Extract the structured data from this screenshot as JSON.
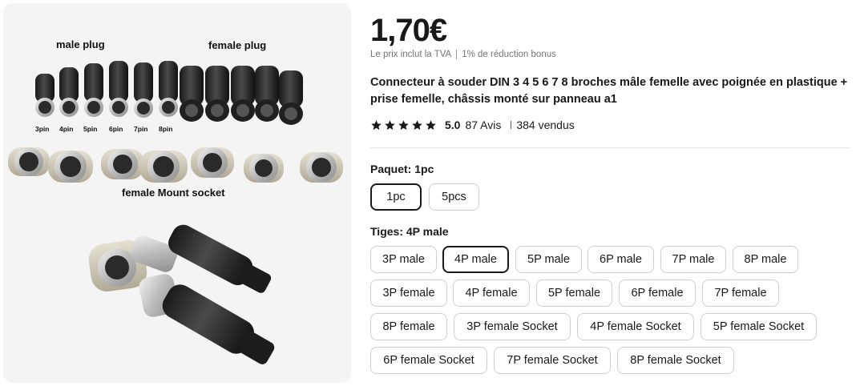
{
  "product": {
    "price": "1,70€",
    "tax_note": "Le prix inclut la TVA",
    "discount_note": "1% de réduction bonus",
    "title": "Connecteur à souder DIN 3 4 5 6 7 8 broches mâle femelle avec poignée en plastique + prise femelle, châssis monté sur panneau a1",
    "rating": "5.0",
    "reviews": "87 Avis",
    "sold": "384 vendus",
    "star_color": "#191919"
  },
  "image": {
    "label_male": "male plug",
    "label_female": "female plug",
    "label_mount": "female Mount  socket",
    "pins": [
      "3pin",
      "4pin",
      "5pin",
      "6pin",
      "7pin",
      "8pin"
    ]
  },
  "package": {
    "label": "Paquet: 1pc",
    "options": [
      "1pc",
      "5pcs"
    ],
    "selected": "1pc"
  },
  "stems": {
    "label": "Tiges: 4P male",
    "options": [
      "3P male",
      "4P male",
      "5P male",
      "6P male",
      "7P male",
      "8P male",
      "3P female",
      "4P female",
      "5P female",
      "6P female",
      "7P female",
      "8P female",
      "3P female Socket",
      "4P female Socket",
      "5P female Socket",
      "6P female Socket",
      "7P female Socket",
      "8P female Socket"
    ],
    "selected": "4P male"
  }
}
